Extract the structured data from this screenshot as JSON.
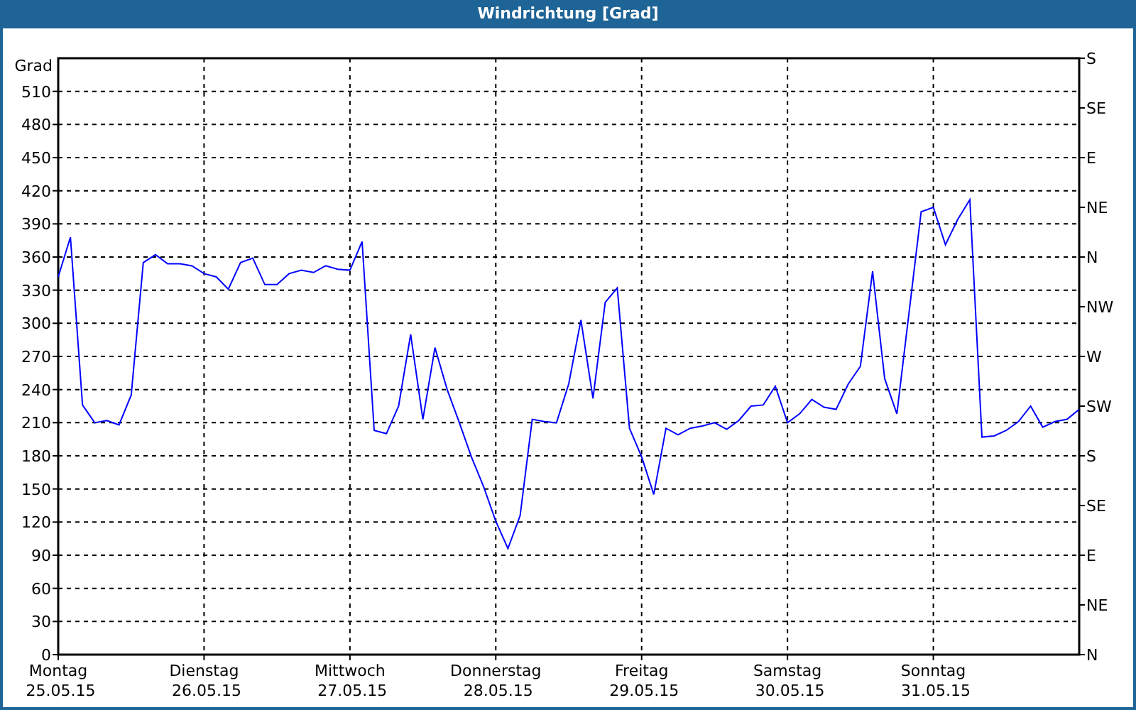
{
  "window": {
    "title": "Windrichtung [Grad]"
  },
  "chart": {
    "compass_labels": [
      "S",
      "SE",
      "E",
      "NE",
      "N",
      "NW",
      "W",
      "SW",
      "S",
      "SE",
      "E",
      "NE",
      "N"
    ],
    "chart_data": {
      "type": "line",
      "grid": true,
      "ylabel": "Grad",
      "ylim": [
        0,
        540
      ],
      "yticks": [
        0,
        30,
        60,
        90,
        120,
        150,
        180,
        210,
        240,
        270,
        300,
        330,
        360,
        390,
        420,
        450,
        480,
        510
      ],
      "categories": [
        "Montag\n25.05.15",
        null,
        null,
        null,
        null,
        null,
        null,
        null,
        null,
        null,
        null,
        null,
        "Dienstag\n26.05.15",
        null,
        null,
        null,
        null,
        null,
        null,
        null,
        null,
        null,
        null,
        null,
        "Mittwoch\n27.05.15",
        null,
        null,
        null,
        null,
        null,
        null,
        null,
        null,
        null,
        null,
        null,
        "Donnerstag\n28.05.15",
        null,
        null,
        null,
        null,
        null,
        null,
        null,
        null,
        null,
        null,
        null,
        "Freitag\n29.05.15",
        null,
        null,
        null,
        null,
        null,
        null,
        null,
        null,
        null,
        null,
        null,
        "Samstag\n30.05.15",
        null,
        null,
        null,
        null,
        null,
        null,
        null,
        null,
        null,
        null,
        null,
        "Sonntag\n31.05.15",
        null,
        null,
        null,
        null,
        null,
        null,
        null,
        null,
        null,
        null,
        null,
        null
      ],
      "series": [
        {
          "color": "#0000ff",
          "values": [
            342,
            378,
            226,
            210,
            212,
            208,
            235,
            355,
            362,
            354,
            354,
            352,
            345,
            342,
            331,
            355,
            359,
            335,
            335,
            345,
            348,
            346,
            352,
            349,
            348,
            374,
            203,
            200,
            225,
            290,
            213,
            278,
            240,
            210,
            179,
            152,
            121,
            96,
            126,
            213,
            211,
            210,
            245,
            303,
            232,
            319,
            332,
            205,
            179,
            145,
            205,
            199,
            205,
            207,
            210,
            204,
            212,
            225,
            226,
            243,
            210,
            218,
            231,
            224,
            222,
            245,
            261,
            347,
            250,
            218,
            310,
            401,
            405,
            371,
            394,
            412,
            197,
            198,
            203,
            211,
            225,
            206,
            211,
            213,
            222
          ]
        }
      ]
    }
  }
}
